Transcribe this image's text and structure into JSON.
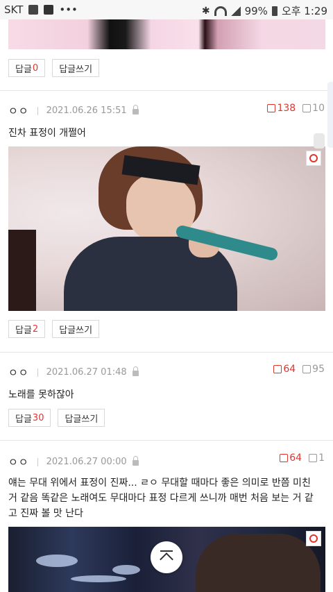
{
  "status_bar": {
    "carrier": "SKT",
    "battery": "99%",
    "time": "오후 1:29"
  },
  "posts": [
    {
      "reply_label": "답글",
      "reply_count": "0",
      "write_label": "답글쓰기"
    },
    {
      "author": "ㅇㅇ",
      "date": "2021.06.26 15:51",
      "likes": "138",
      "dislikes": "10",
      "text": "진차 표정이 개쩔어",
      "reply_label": "답글",
      "reply_count": "2",
      "write_label": "답글쓰기"
    },
    {
      "author": "ㅇㅇ",
      "date": "2021.06.27 01:48",
      "likes": "64",
      "dislikes": "95",
      "text": "노래를 못하잖아",
      "reply_label": "답글",
      "reply_count": "30",
      "write_label": "답글쓰기"
    },
    {
      "author": "ㅇㅇ",
      "date": "2021.06.27 00:00",
      "likes": "64",
      "dislikes": "1",
      "text": "얘는 무대 위에서 표정이 진짜... ㄹㅇ 무대할 때마다 좋은 의미로 반쯤 미친 거 같음 똑같은 노래여도 무대마다 표정 다르게 쓰니까 매번 처음 보는 거 같고 진짜 볼 맛 난다"
    }
  ]
}
